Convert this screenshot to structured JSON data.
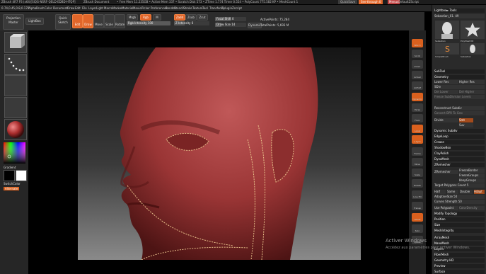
{
  "titlebar": {
    "app": "ZBrush 4R7 P3 (x64)[SIQG-NSRF-QELD-EDBD-HTQP]",
    "doc": "ZBrush Document",
    "mem": "• Free Mem 11.235GB • Active Mem 337 • Scratch Disk 573 • ZTime 1.774 Timer 0.554 • PolyCount 775.582 KP • MeshCount 1",
    "quicksave": "QuickSave",
    "seethrough": "See-through 0",
    "menus": "Menus",
    "script": "DefaultZScript"
  },
  "menubar": {
    "items": [
      "Alpha",
      "Brush",
      "Color",
      "Document",
      "Draw",
      "Edit",
      "File",
      "Layer",
      "Light",
      "Macro",
      "Marker",
      "Material",
      "Movie",
      "Picker",
      "Preferences",
      "Render",
      "Stencil",
      "Stroke",
      "Texture",
      "Tool",
      "Transform",
      "Zplugin",
      "Zscript"
    ],
    "coords": "0.74,0.45,0.8,0.170"
  },
  "toolbar": {
    "projection_master": "Projection Master",
    "lightbox": "LightBox",
    "quick_sketch": "Quick Sketch",
    "edit": "Edit",
    "draw": "Draw",
    "move": "Move",
    "scale": "Scale",
    "rotate": "Rotate",
    "mrgb": "Mrgb",
    "rgb": "Rgb",
    "m": "M",
    "zadd": "Zadd",
    "zsub": "Zsub",
    "zcut": "Zcut",
    "rgb_intensity": "Rgb Intensity 100",
    "z_intensity": "Z Intensity 6",
    "focal_shift": "Focal Shift 0",
    "draw_size": "Draw Size 14",
    "dynamic": "Dynamic",
    "active_points": "ActivePoints: 75,284",
    "total_points": "TotalPoints: 5,693 M"
  },
  "leftpanel": {
    "gradient": "Gradient",
    "switch_color": "SwitchColor",
    "alternate": "Alternate"
  },
  "rightshelf": {
    "buttons": [
      "SPix 3",
      "Scroll",
      "Zoom",
      "Actual",
      "AAHalf",
      "Dynamic",
      "Persp",
      "Floor",
      "Local",
      "L.Sym",
      "Frame",
      "Move",
      "Scale",
      "Rotate",
      "Line Fill",
      "Transp",
      "Ghost",
      "Solo",
      "Xpose"
    ]
  },
  "rightpanel": {
    "lightbox_tools": "Lightbox► Tools",
    "tool_name": "Sebastian_01. 49",
    "tools": [
      "Sebastian",
      "PolyMesh3D",
      "SimpleBrush",
      "Sebastian"
    ],
    "subtool": "SubTool",
    "geometry": "Geometry",
    "lower_res": "Lower Res",
    "higher_res": "Higher Res",
    "sdiv": "SDiv",
    "del_lower": "Del Lower",
    "del_higher": "Del Higher",
    "freeze_subdivision": "Freeze SubDivision Levels",
    "reconstruct_subdiv": "Reconstruct Subdiv",
    "convert_bpr": "Convert BPR To Geo",
    "divide": "Divide",
    "smt": "Smt",
    "suv": "Suv",
    "dynamic_subdiv": "Dynamic Subdiv",
    "edgeloop": "EdgeLoop",
    "crease": "Crease",
    "shadowbox": "ShadowBox",
    "claypolish": "ClayPolish",
    "dynamesh": "DynaMesh",
    "zremesher": "ZRemesher",
    "zremesher_btn": "ZRemesher",
    "freeze_border": "FreezeBorder",
    "freeze_groups": "FreezeGroups",
    "keep_groups": "KeepGroups",
    "target_polygons": "Target Polygons Count 5",
    "half": "Half",
    "same": "Same",
    "double": "Double",
    "adapt": "Adapt",
    "adaptive_size": "AdaptiveSize 50",
    "curves_strength": "Curves Strength 50",
    "use_polypaint": "Use Polypaint",
    "color_density": "ColorDensity",
    "modify_topology": "Modify Topology",
    "position": "Position",
    "size": "Size",
    "meshintegrity": "MeshIntegrity",
    "arraymesh": "ArrayMesh",
    "nanomesh": "NanoMesh",
    "layers": "Layers",
    "fibermesh": "FiberMesh",
    "geometry_hd": "Geometry HD",
    "preview": "Preview",
    "surface": "Surface"
  },
  "watermark": {
    "line1": "Activer Windows",
    "line2": "Accédez aux paramètres pour activer Windows."
  }
}
